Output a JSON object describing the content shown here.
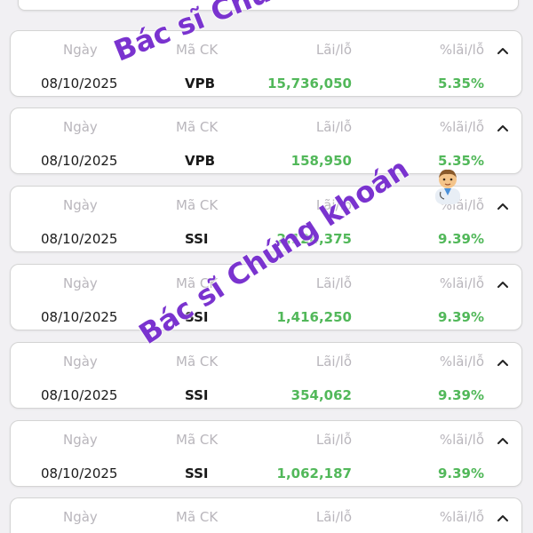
{
  "columns": {
    "date": "Ngày",
    "symbol": "Mã CK",
    "pnl": "Lãi/lỗ",
    "pct": "%lãi/lỗ"
  },
  "trades": [
    {
      "date": "08/10/2025",
      "symbol": "VPB",
      "pnl": "15,736,050",
      "pct": "5.35%"
    },
    {
      "date": "08/10/2025",
      "symbol": "VPB",
      "pnl": "158,950",
      "pct": "5.35%"
    },
    {
      "date": "08/10/2025",
      "symbol": "SSI",
      "pnl": "2,124,375",
      "pct": "9.39%"
    },
    {
      "date": "08/10/2025",
      "symbol": "SSI",
      "pnl": "1,416,250",
      "pct": "9.39%"
    },
    {
      "date": "08/10/2025",
      "symbol": "SSI",
      "pnl": "354,062",
      "pct": "9.39%"
    },
    {
      "date": "08/10/2025",
      "symbol": "SSI",
      "pnl": "1,062,187",
      "pct": "9.39%"
    },
    {
      "date": "",
      "symbol": "",
      "pnl": "",
      "pct": ""
    }
  ],
  "chevron_icon": "chevron-up-icon",
  "colors": {
    "profit": "#52b85a",
    "header_text": "#b9b6bc",
    "watermark": "#7a33cf"
  },
  "watermarks": [
    "Bác sĩ Chứng khoán",
    "Bác sĩ Chứng khoán"
  ]
}
